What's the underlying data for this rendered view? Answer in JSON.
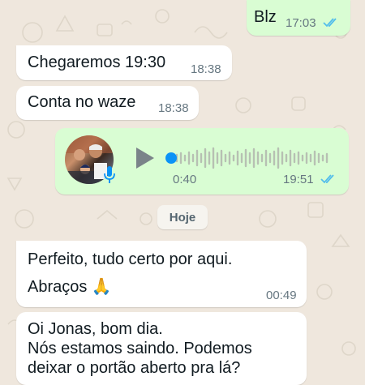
{
  "messages": [
    {
      "direction": "out",
      "text": "Blz",
      "time": "17:03",
      "status": "read"
    },
    {
      "direction": "in",
      "text": "Chegaremos 19:30",
      "time": "18:38"
    },
    {
      "direction": "in",
      "text": "Conta no waze",
      "time": "18:38"
    },
    {
      "direction": "out",
      "type": "voice",
      "duration": "0:40",
      "time": "19:51",
      "status": "read",
      "playback_progress": 0
    },
    {
      "direction": "in",
      "text_line1": "Perfeito, tudo certo por aqui.",
      "text_line2": "Abraços 🙏",
      "time": "00:49"
    },
    {
      "direction": "in",
      "text_line1": "Oi Jonas, bom dia.",
      "text_line2": "Nós estamos saindo. Podemos",
      "text_line3": "deixar o portão aberto pra lá?"
    }
  ],
  "date_separator": "Hoje",
  "colors": {
    "chat_background": "#efe7dd",
    "incoming_bubble": "#ffffff",
    "outgoing_bubble": "#d9fdd3",
    "read_ticks": "#53bdeb",
    "voice_accent": "#0b93f6"
  },
  "icons": [
    "double-check-icon",
    "play-icon",
    "microphone-icon",
    "avatar"
  ]
}
